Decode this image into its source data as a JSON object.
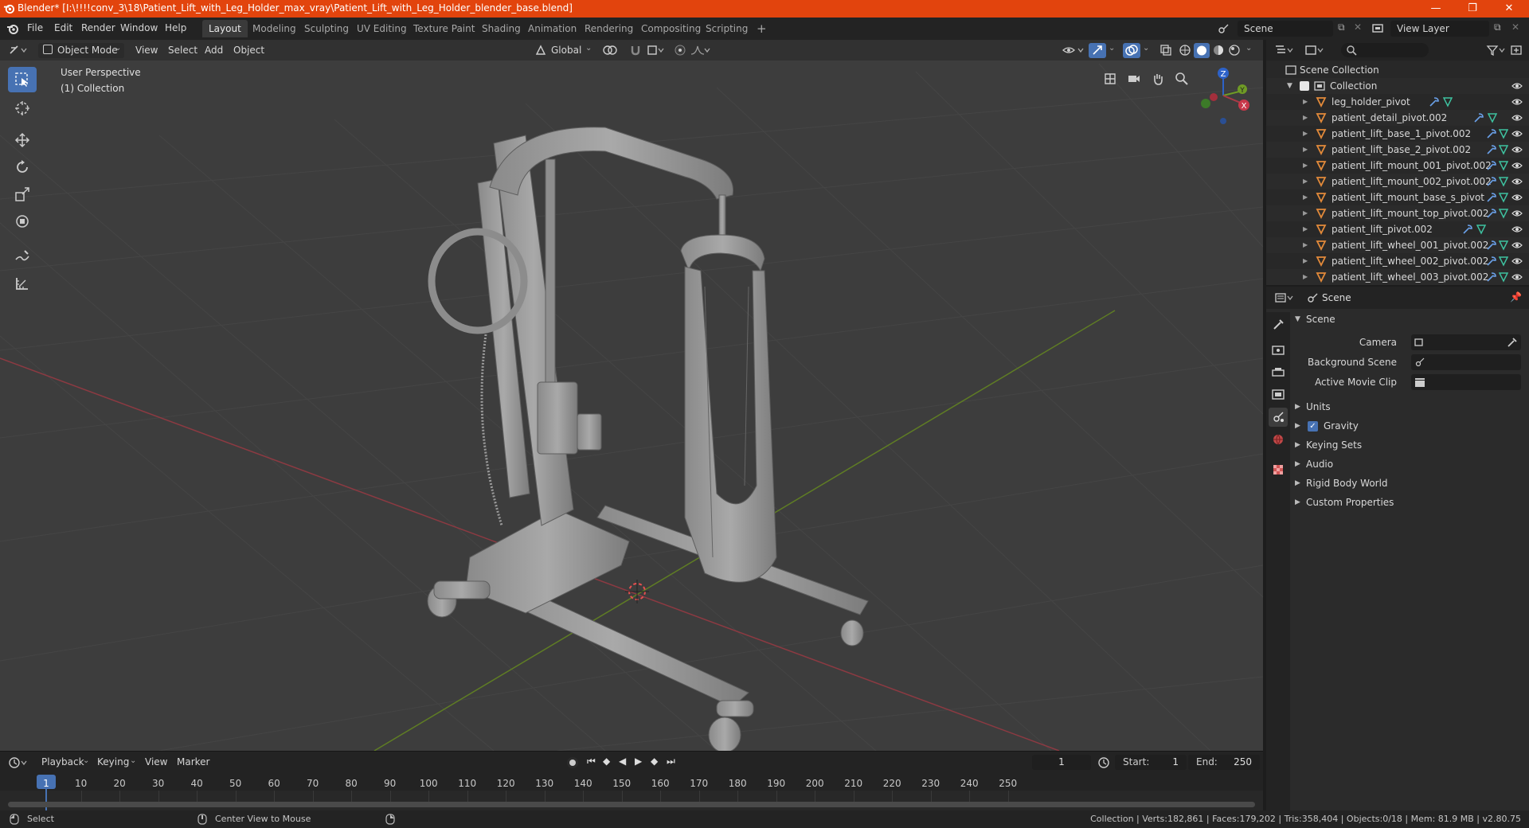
{
  "titlebar": {
    "title": "Blender* [I:\\!!!!conv_3\\18\\Patient_Lift_with_Leg_Holder_max_vray\\Patient_Lift_with_Leg_Holder_blender_base.blend]",
    "minimize": "—",
    "restore": "❐",
    "close": "✕"
  },
  "menu": [
    "File",
    "Edit",
    "Render",
    "Window",
    "Help"
  ],
  "workspaces": [
    "Layout",
    "Modeling",
    "Sculpting",
    "UV Editing",
    "Texture Paint",
    "Shading",
    "Animation",
    "Rendering",
    "Compositing",
    "Scripting"
  ],
  "workspace_add": "+",
  "scene_field": "Scene",
  "view_layer_field": "View Layer",
  "viewport": {
    "mode": "Object Mode",
    "menus": [
      "View",
      "Select",
      "Add",
      "Object"
    ],
    "orientation": "Global",
    "perspective_label": "User Perspective",
    "collection_label": "(1) Collection",
    "gizmo": {
      "z": "Z",
      "y": "Y",
      "x": "X"
    }
  },
  "outliner": {
    "root": "Scene Collection",
    "collection": "Collection",
    "items": [
      "leg_holder_pivot",
      "patient_detail_pivot.002",
      "patient_lift_base_1_pivot.002",
      "patient_lift_base_2_pivot.002",
      "patient_lift_mount_001_pivot.002",
      "patient_lift_mount_002_pivot.002",
      "patient_lift_mount_base_s_pivot",
      "patient_lift_mount_top_pivot.002",
      "patient_lift_pivot.002",
      "patient_lift_wheel_001_pivot.002",
      "patient_lift_wheel_002_pivot.002",
      "patient_lift_wheel_003_pivot.002"
    ]
  },
  "properties": {
    "header": "Scene",
    "section": "Scene",
    "fields": [
      {
        "label": "Camera"
      },
      {
        "label": "Background Scene"
      },
      {
        "label": "Active Movie Clip"
      }
    ],
    "panels": [
      "Units",
      "Gravity",
      "Keying Sets",
      "Audio",
      "Rigid Body World",
      "Custom Properties"
    ]
  },
  "timeline": {
    "menus": [
      "Playback",
      "Keying",
      "View",
      "Marker"
    ],
    "current_frame": "1",
    "start_label": "Start:",
    "start": "1",
    "end_label": "End:",
    "end": "250",
    "ticks": [
      "1",
      "10",
      "20",
      "30",
      "40",
      "50",
      "60",
      "70",
      "80",
      "90",
      "100",
      "110",
      "120",
      "130",
      "140",
      "150",
      "160",
      "170",
      "180",
      "190",
      "200",
      "210",
      "220",
      "230",
      "240",
      "250"
    ]
  },
  "statusbar": {
    "select": "Select",
    "center_view": "Center View to Mouse",
    "stats": "Collection | Verts:182,861 | Faces:179,202 | Tris:358,404 | Objects:0/18 | Mem: 81.9 MB | v2.80.75"
  },
  "colors": {
    "titlebar": "#e2440d",
    "accent": "#4772b3",
    "object_icon": "#e38a3a",
    "modifier_icon": "#6aa0e8",
    "mesh_icon": "#3ec2a0",
    "x_axis": "#a83a46",
    "y_axis": "#6f9b25",
    "z_axis": "#2d62c8"
  }
}
